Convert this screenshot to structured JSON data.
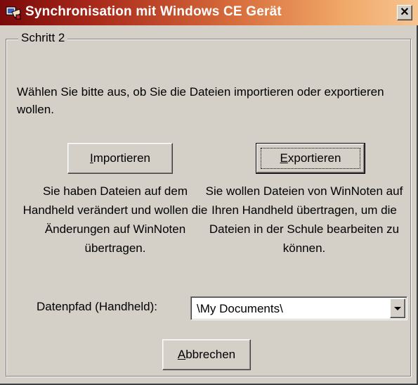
{
  "window": {
    "title": "Synchronisation mit Windows CE Gerät",
    "close_glyph": "✕",
    "icon": "app-icon",
    "title_gradient_start": "#7a0a0a",
    "title_gradient_end": "#f7c490"
  },
  "group": {
    "label": "Schritt 2"
  },
  "instruction": "Wählen Sie bitte aus, ob Sie die Dateien importieren oder exportieren wollen.",
  "import": {
    "mnemonic": "I",
    "label_rest": "mportieren",
    "description": "Sie haben Dateien auf dem Handheld verändert und wollen die Änderungen auf WinNoten übertragen."
  },
  "export": {
    "mnemonic": "E",
    "label_rest": "xportieren",
    "description": "Sie wollen Dateien von WinNoten auf Ihren Handheld übertragen, um die Dateien in der Schule bearbeiten zu können."
  },
  "path": {
    "label": "Datenpfad (Handheld):",
    "value": "\\My Documents\\"
  },
  "cancel": {
    "mnemonic": "A",
    "label_rest": "bbrechen"
  }
}
